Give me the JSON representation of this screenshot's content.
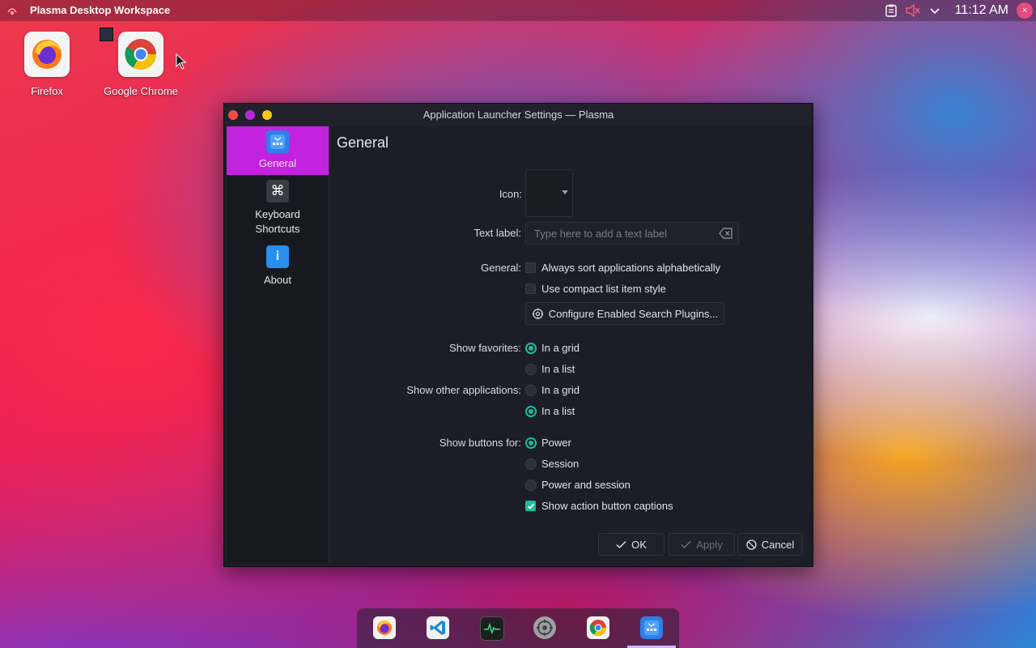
{
  "panel": {
    "title": "Plasma Desktop Workspace",
    "clock": "11:12 AM",
    "icons": [
      "kde-logo-icon",
      "clipboard-icon",
      "volume-muted-icon",
      "chevron-down-icon",
      "user-avatar-icon"
    ]
  },
  "desktop": {
    "icons": [
      {
        "label": "Firefox",
        "icon": "firefox-icon"
      },
      {
        "label": "Google Chrome",
        "icon": "chrome-icon"
      }
    ]
  },
  "window": {
    "title": "Application Launcher Settings — Plasma",
    "sidebar": {
      "items": [
        {
          "label": "General",
          "icon": "launcher-icon",
          "active": true
        },
        {
          "label": "Keyboard Shortcuts",
          "icon": "command-key-icon",
          "active": false
        },
        {
          "label": "About",
          "icon": "info-icon",
          "active": false
        }
      ]
    },
    "page": {
      "title": "General",
      "icon_label": "Icon:",
      "text_label": "Text label:",
      "text_placeholder": "Type here to add a text label",
      "general_label": "General:",
      "checks": [
        {
          "label": "Always sort applications alphabetically",
          "checked": false
        },
        {
          "label": "Use compact list item style",
          "checked": false
        }
      ],
      "configure_button": "Configure Enabled Search Plugins...",
      "show_favorites_label": "Show favorites:",
      "favorites_options": [
        {
          "label": "In a grid",
          "selected": true
        },
        {
          "label": "In a list",
          "selected": false
        }
      ],
      "show_other_label": "Show other applications:",
      "other_options": [
        {
          "label": "In a grid",
          "selected": false
        },
        {
          "label": "In a list",
          "selected": true
        }
      ],
      "show_buttons_label": "Show buttons for:",
      "buttons_options": [
        {
          "label": "Power",
          "selected": true
        },
        {
          "label": "Session",
          "selected": false
        },
        {
          "label": "Power and session",
          "selected": false
        }
      ],
      "captions_check": {
        "label": "Show action button captions",
        "checked": true
      }
    },
    "footer": {
      "ok": "OK",
      "apply": "Apply",
      "cancel": "Cancel"
    }
  },
  "dock": {
    "items": [
      "firefox-icon",
      "vscode-icon",
      "system-monitor-icon",
      "system-settings-icon",
      "chrome-icon",
      "launcher-icon"
    ]
  },
  "colors": {
    "accent": "#c322de",
    "check": "#1abc9c",
    "window_bg": "#1c1d26"
  }
}
